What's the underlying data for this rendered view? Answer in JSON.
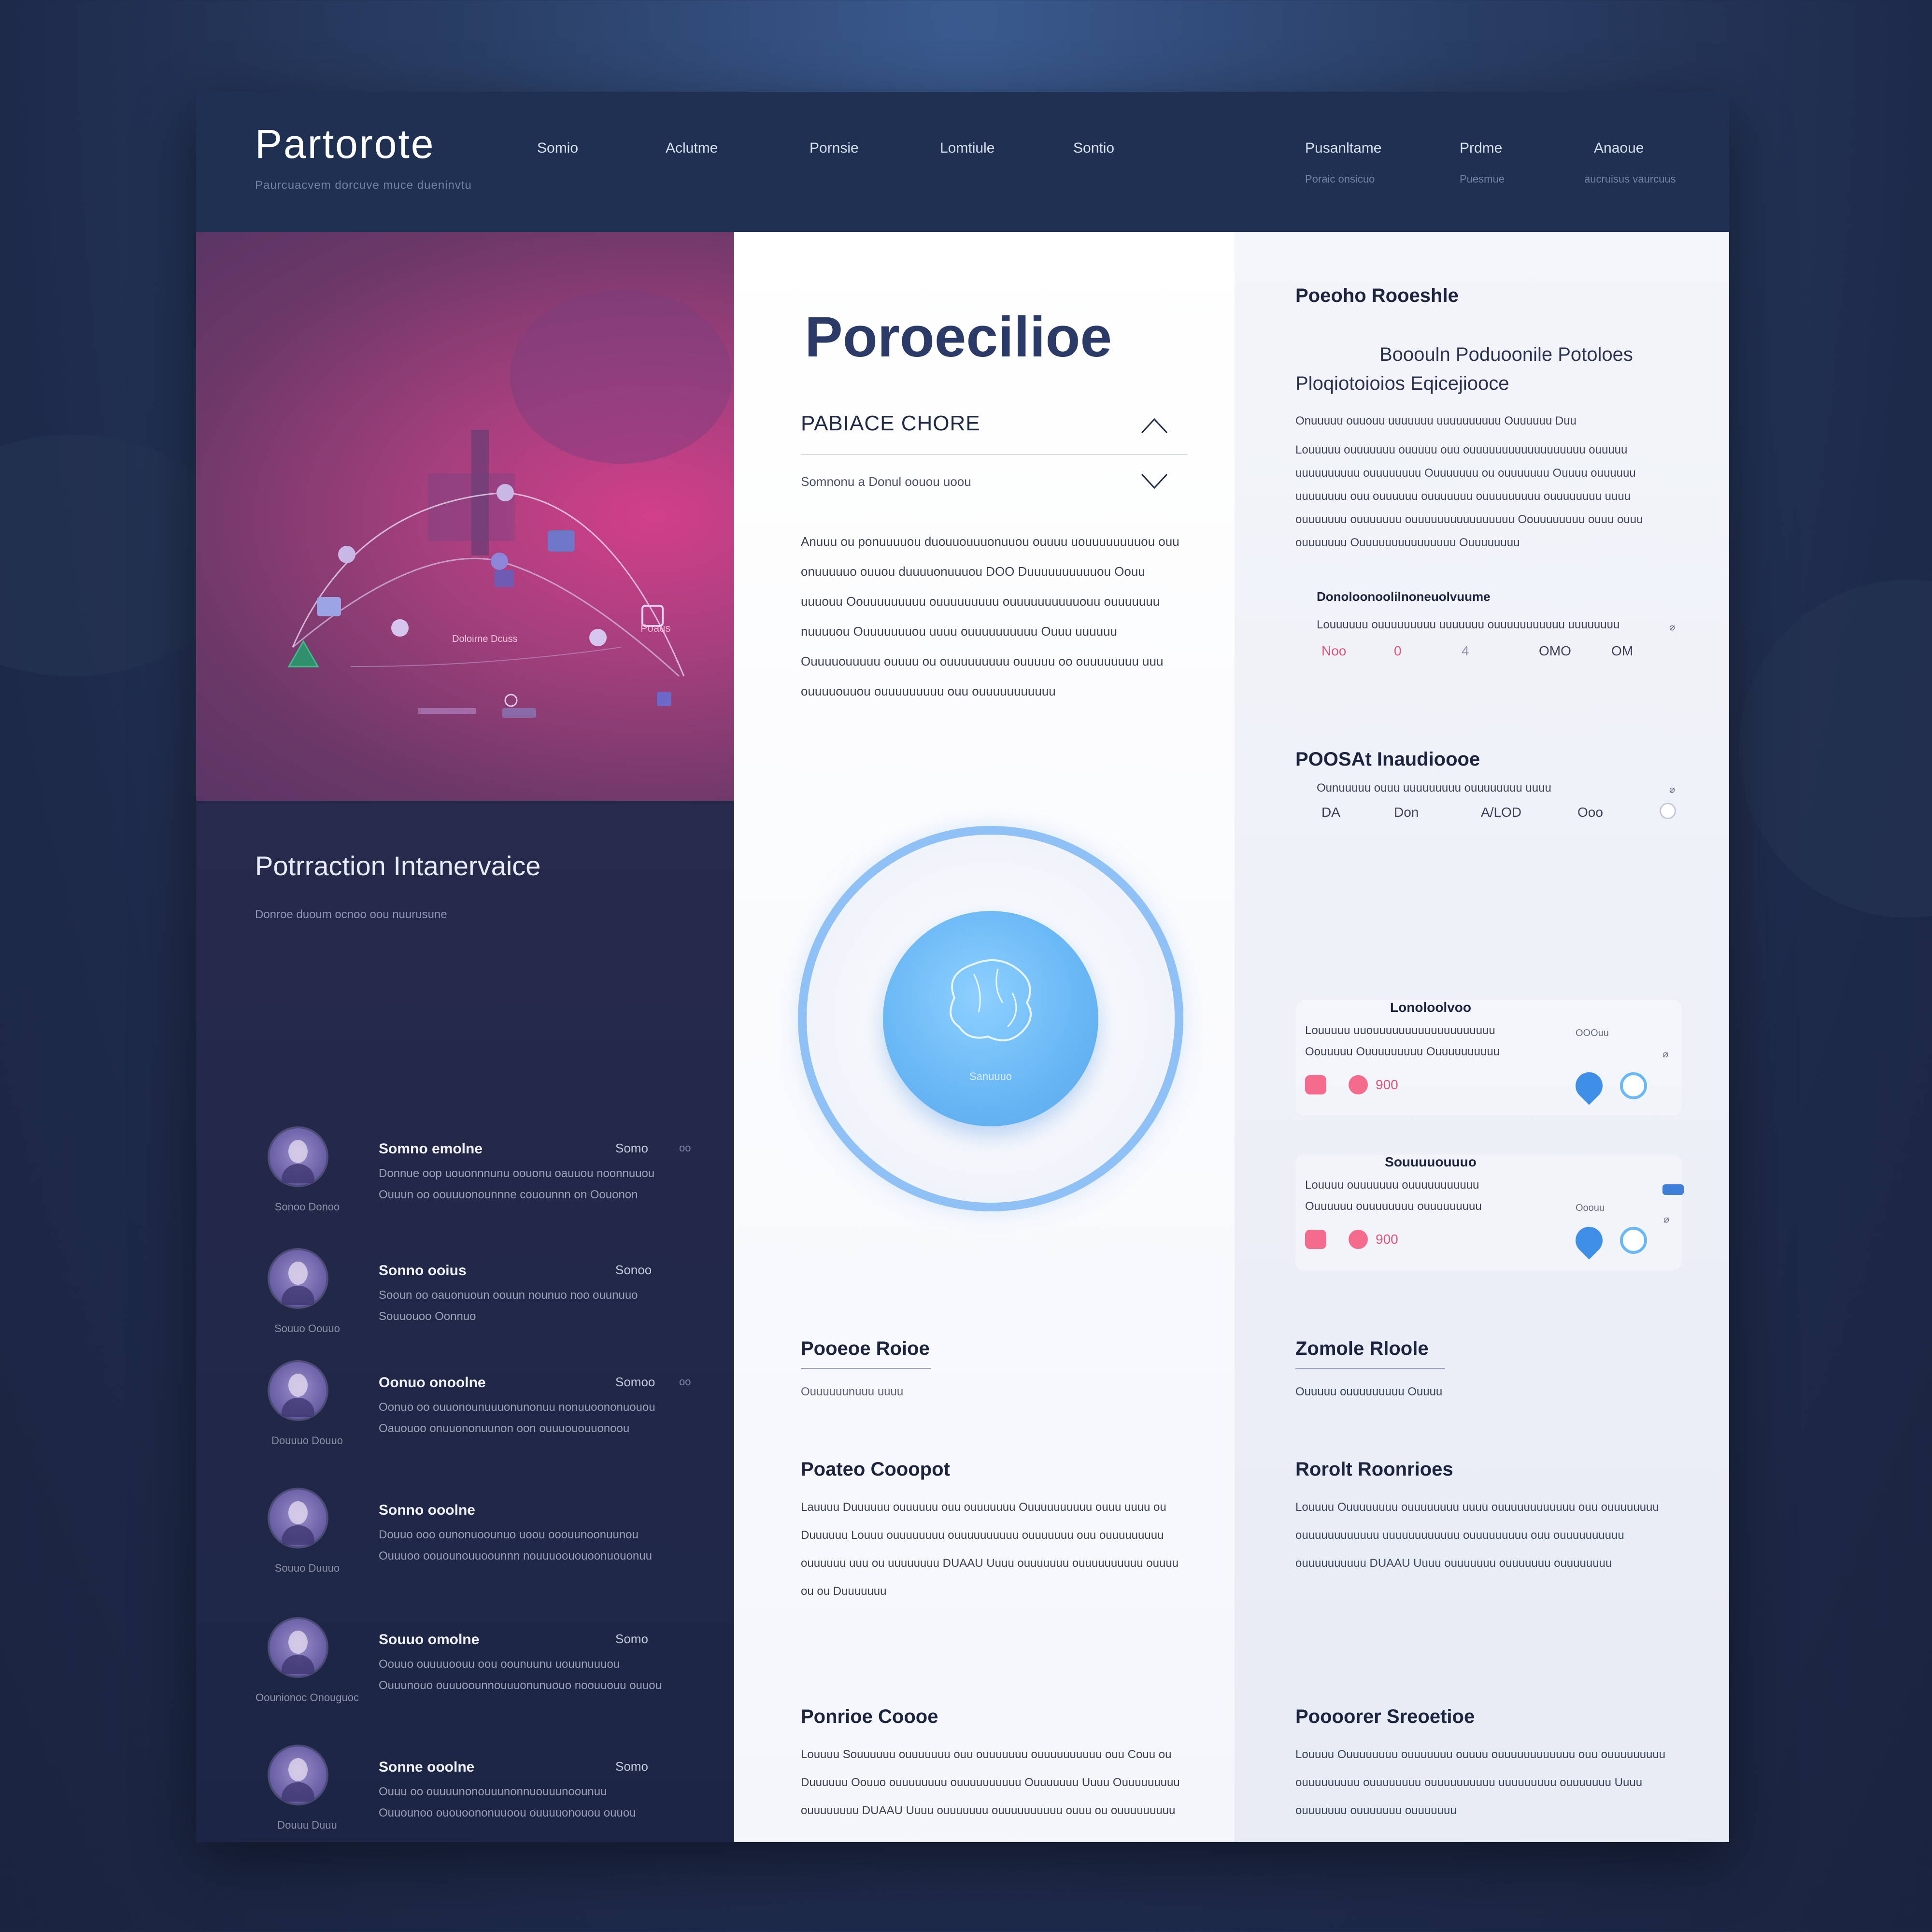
{
  "nav": {
    "brand": "Partorote",
    "brand_sub": "Paurcuacvem dorcuve muce dueninvtu",
    "links": [
      "Somio",
      "Aclutme",
      "Pornsie",
      "Lomtiule",
      "Sontio"
    ],
    "right_links": [
      {
        "label": "Pusanltame",
        "sub": "Poraic onsicuo"
      },
      {
        "label": "Prdme",
        "sub": "Puesmue"
      },
      {
        "label": "Anaoue",
        "sub": "aucruisus vaurcuus"
      }
    ]
  },
  "hero": {
    "label": "Poaus",
    "chart_caption": "Doloirne Dcuss"
  },
  "left_section": {
    "title": "Potrraction Intanervaice",
    "subtitle": "Donroe duoum ocnoo oou nuurusune",
    "people": [
      {
        "name": "Somno emolne",
        "right": "Somo",
        "extra": "oo",
        "caption": "Sonoo Donoo",
        "line1": "Donnue oop uouonnnunu oouonu oauuou noonnuuou",
        "line2": "Ouuun oo oouuuonounnne couounnn on Oouonon"
      },
      {
        "name": "Sonno ooius",
        "right": "Sonoo",
        "extra": "",
        "caption": "Souuo Oouuo",
        "line1": "Sooun oo oauonuoun oouun nounuo noo ouunuuo",
        "line2": "Souuouoo Oonnuo"
      },
      {
        "name": "Oonuo onoolne",
        "right": "Somoo",
        "extra": "oo",
        "caption": "Douuuo Douuo",
        "line1": "Oonuo oo ouuonounuuuonunonuu nonuuoononuouou",
        "line2": "Oauouoo onuuononuunon oon ouuuououuonoou"
      },
      {
        "name": "Sonno ooolne",
        "right": "",
        "extra": "",
        "caption": "Souuo Duuuo",
        "line1": "Douuo ooo ounonuoounuo uoou ooouunoonuunou",
        "line2": "Ouuuoo oouounouuoounnn nouuuoououoonuouonuu"
      },
      {
        "name": "Souuo omolne",
        "right": "Somo",
        "extra": "",
        "caption": "Oounionoc Onouguoc",
        "line1": "Oouuo ouuuuoouu oou oounuunu uouunuuuou",
        "line2": "Ouuunouo ouuuoounnouuuonunuouo noouuouu ouuou"
      },
      {
        "name": "Sonne ooolne",
        "right": "Somo",
        "extra": "",
        "caption": "Douuu Duuu",
        "line1": "Ouuu oo ouuuunonouuunonnuouuunoounuu",
        "line2": "Ouuounoo ououoononuuoou ouuuuonouou ouuou"
      }
    ]
  },
  "middle": {
    "title": "Poroecilioe",
    "accordion_title": "PABIACE CHORE",
    "accordion_sub": "Somnonu a Donul oouou uoou",
    "paragraph": "Anuuu ou ponuuuuou duouuouuuonuuou ouuuu uouuuuuuuuou ouu onuuuuuo ouuou duuuuonuuuou DOO Duuuuuuuuuuou Oouu uuuouu Oouuuuuuuuu ouuuuuuuuu ouuuuuuuuuuouu ouuuuuuu nuuuuou Ouuuuuuuou uuuu ouuuuuuuuuu Ouuu uuuuuu Ouuuuouuuuu ouuuu ou ouuuuuuuuu ouuuuu oo ouuuuuuuu uuu ouuuuouuou ouuuuuuuuu ouu ouuuuuuuuuuu",
    "orb_label": "Sanuuuo",
    "blocks": [
      {
        "title": "Pooeoe Roioe",
        "sub": "Ouuuuuunuuu uuuu"
      },
      {
        "title": "Poateo Cooopot",
        "text": "Lauuuu Duuuuuu ouuuuuu ouu ouuuuuuu Ouuuuuuuuuu ouuu uuuu ou Duuuuuu Louuu ouuuuuuuu ouuuuuuuuuu ouuuuuuu ouu ouuuuuuuuu ouuuuuu uuu ou uuuuuuuu DUAAU Uuuu ouuuuuuu ouuuuuuuuuu ouuuu ou ou Duuuuuuu"
      },
      {
        "title": "Ponrioe Coooe",
        "text": "Louuuu Souuuuuu ouuuuuuu ouu ouuuuuuu ouuuuuuuuuu ouu Couu ou Duuuuuu Oouuo ouuuuuuuu ouuuuuuuuuu Ouuuuuuu Uuuu Ouuuuuuuuu ouuuuuuuu DUAAU Uuuu ouuuuuuu ouuuuuuuuuu ouuu ou ouuuuuuuuu"
      }
    ]
  },
  "right": {
    "title1": "Poeoho Rooeshle",
    "text_a": "Booouln Poduoonile Potoloes",
    "text_b": "Ploqiotoioios Eqicejiooce",
    "line_small": "Onuuuuu ouuouu uuuuuuu uuuuuuuuuu Ouuuuuu Duu",
    "para1": "Louuuuu ouuuuuuu ouuuuu ouu ouuuuuuuuuuuuuuuuuu ouuuuu uuuuuuuuuu ouuuuuuuu Ouuuuuuu ou ouuuuuuu Ouuuu ouuuuuu uuuuuuuu ouu ouuuuuu ouuuuuuu ouuuuuuuuu ouuuuuuuu uuuu ouuuuuuu ouuuuuuu ouuuuuuuuuuuuuuuu Oouuuuuuuu ouuu ouuu ouuuuuuu Ouuuuuuuuuuuuuuu Ouuuuuuuu",
    "sub1": "Donoloonoolilnoneuolvuume",
    "sub1_line": "Louuuuuu ouuuuuuuuu uuuuuuu ouuuuuuuuuuu uuuuuuuu",
    "stats1": [
      "Noo",
      "0",
      "4",
      "OMO",
      "OM"
    ],
    "sub2": "POOSAt Inaudioooe",
    "sub2_line": "Ounuuuuu ouuu uuuuuuuuu ouuuuuuuu uuuu",
    "stats2": [
      "DA",
      "Don",
      "A/LOD",
      "Ooo"
    ],
    "card1": {
      "title": "Lonoloolvoo",
      "line1": "Louuuuu uuouuuuuuuuuuuuuuuuuuu",
      "line2": "Oouuuuu Ouuuuuuuuu Ouuuuuuuuuu",
      "right": "OOOuu",
      "value": "900"
    },
    "card2": {
      "title": "Souuuuouuuo",
      "line1": "Louuuu ouuuuuuu ouuuuuuuuuuu",
      "line2": "Ouuuuuu ouuuuuuuu ouuuuuuuuu",
      "right": "Ooouu",
      "value": "900"
    },
    "block1": {
      "title": "Zomole Rloole",
      "sub": "Ouuuuu ouuuuuuuuu Ouuuu"
    },
    "block2": {
      "title": "Rorolt Roonrioes",
      "text": "Louuuu Ouuuuuuuu ouuuuuuuu uuuu ouuuuuuuuuuuu ouu ouuuuuuuu ouuuuuuuuuuuu uuuuuuuuuuuu ouuuuuuuuu ouu ouuuuuuuuuu ouuuuuuuuuu DUAAU Uuuu ouuuuuuu ouuuuuuu ouuuuuuuu"
    },
    "block3": {
      "title": "Poooorer Sreoetioe",
      "text": "Louuuu Ouuuuuuuu ouuuuuuu ouuuu ouuuuuuuuuuuu ouu ouuuuuuuuu ouuuuuuuuu ouuuuuuuu ouuuuuuuuuu uuuuuuuuu ouuuuuuu Uuuu ouuuuuuu ouuuuuuu ouuuuuuu"
    }
  },
  "colors": {
    "nav": "#1f3052",
    "accent_pink": "#f46b8e",
    "accent_blue": "#3f8ee8",
    "title_navy": "#2b3a66"
  }
}
